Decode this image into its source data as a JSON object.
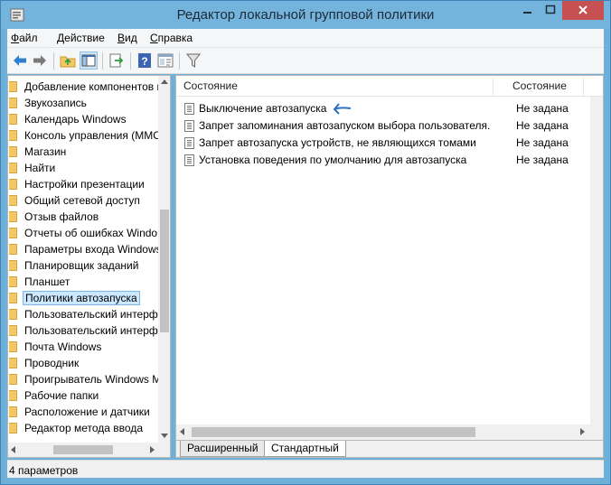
{
  "window": {
    "title": "Редактор локальной групповой политики",
    "accent_color": "#74b4dc",
    "close_color": "#c75050"
  },
  "menu": {
    "items": [
      "Файл",
      "Действие",
      "Вид",
      "Справка"
    ]
  },
  "toolbar": {
    "icons": [
      "back-arrow-icon",
      "forward-arrow-icon",
      "folder-up-icon",
      "show-hide-tree-icon",
      "export-list-icon",
      "help-icon",
      "properties-icon",
      "filter-icon"
    ]
  },
  "tree": {
    "items": [
      "Добавление компонентов в",
      "Звукозапись",
      "Календарь Windows",
      "Консоль управления (MMC",
      "Магазин",
      "Найти",
      "Настройки презентации",
      "Общий сетевой доступ",
      "Отзыв файлов",
      "Отчеты об ошибках Windo",
      "Параметры входа Windows",
      "Планировщик заданий",
      "Планшет",
      "Политики автозапуска",
      "Пользовательский интерф",
      "Пользовательский интерф",
      "Почта Windows",
      "Проводник",
      "Проигрыватель Windows M",
      "Рабочие папки",
      "Расположение и датчики",
      "Редактор метода ввода"
    ],
    "selected_index": 13
  },
  "list": {
    "columns": [
      "Состояние",
      "Состояние"
    ],
    "rows": [
      {
        "name": "Выключение автозапуска",
        "state": "Не задана"
      },
      {
        "name": "Запрет запоминания автозапуском выбора пользователя.",
        "state": "Не задана"
      },
      {
        "name": "Запрет автозапуска устройств, не являющихся томами",
        "state": "Не задана"
      },
      {
        "name": "Установка поведения по умолчанию для автозапуска",
        "state": "Не задана"
      }
    ]
  },
  "tabs": [
    "Расширенный",
    "Стандартный"
  ],
  "status": {
    "text": "4 параметров"
  }
}
